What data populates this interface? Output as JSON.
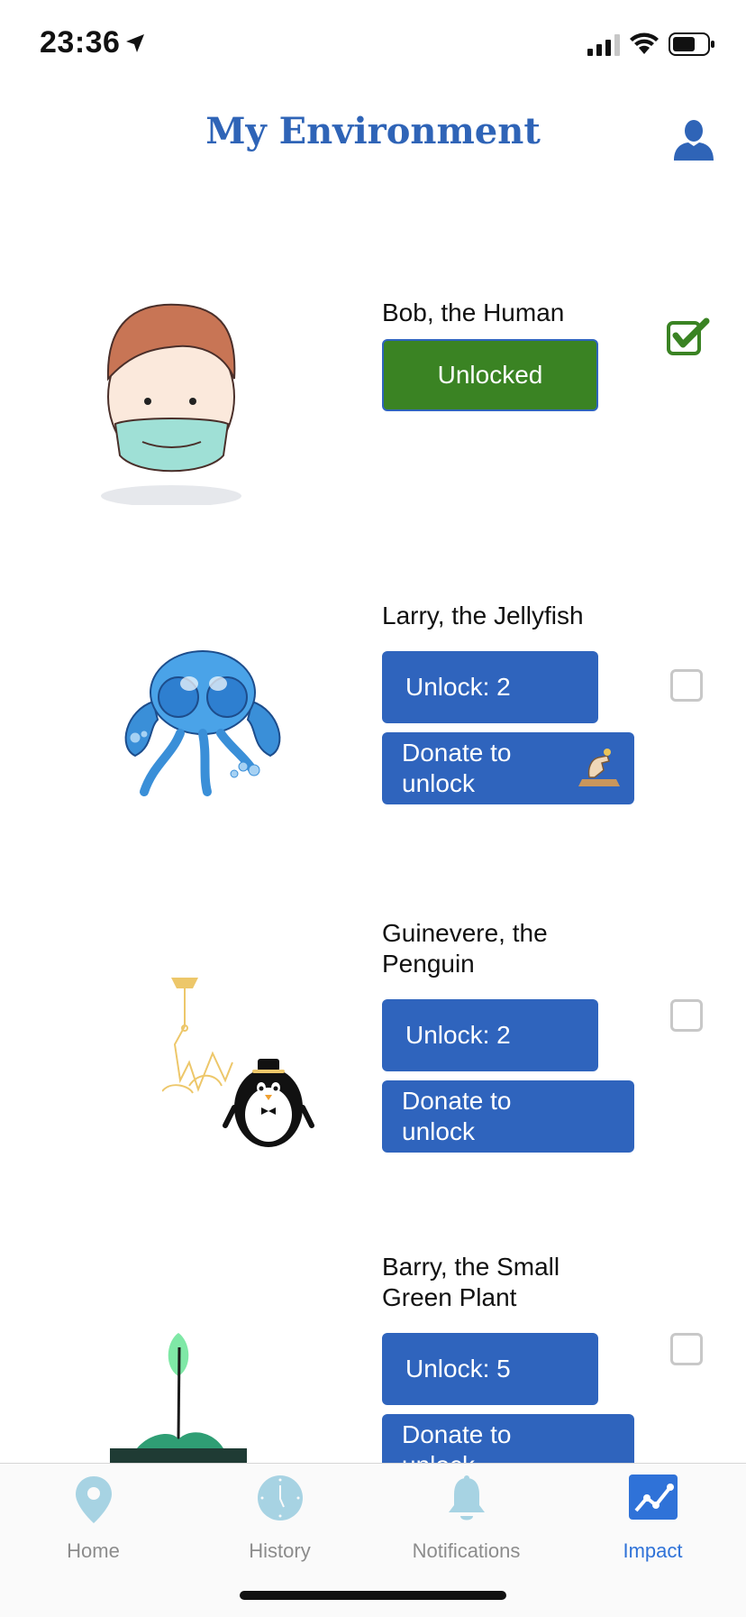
{
  "status_bar": {
    "time": "23:36"
  },
  "header": {
    "title": "My Environment"
  },
  "characters": [
    {
      "name": "Bob, the Human",
      "unlock_label": "Unlocked",
      "checked": true
    },
    {
      "name": "Larry, the Jellyfish",
      "unlock_label": "Unlock: 2",
      "donate_label": "Donate to unlock",
      "checked": false
    },
    {
      "name": "Guinevere, the Penguin",
      "unlock_label": "Unlock: 2",
      "donate_label": "Donate to unlock",
      "checked": false
    },
    {
      "name": "Barry, the Small Green Plant",
      "unlock_label": "Unlock: 5",
      "donate_label": "Donate to unlock",
      "checked": false
    }
  ],
  "tabs": [
    {
      "label": "Home",
      "icon": "map-pin-icon"
    },
    {
      "label": "History",
      "icon": "clock-icon"
    },
    {
      "label": "Notifications",
      "icon": "bell-icon"
    },
    {
      "label": "Impact",
      "icon": "chart-icon",
      "active": true
    }
  ],
  "colors": {
    "accent": "#2f64bd",
    "unlocked": "#3a8323",
    "title": "#2f64b7",
    "tab_active": "#2f72d8",
    "tab_inactive": "#a7d3e3"
  }
}
